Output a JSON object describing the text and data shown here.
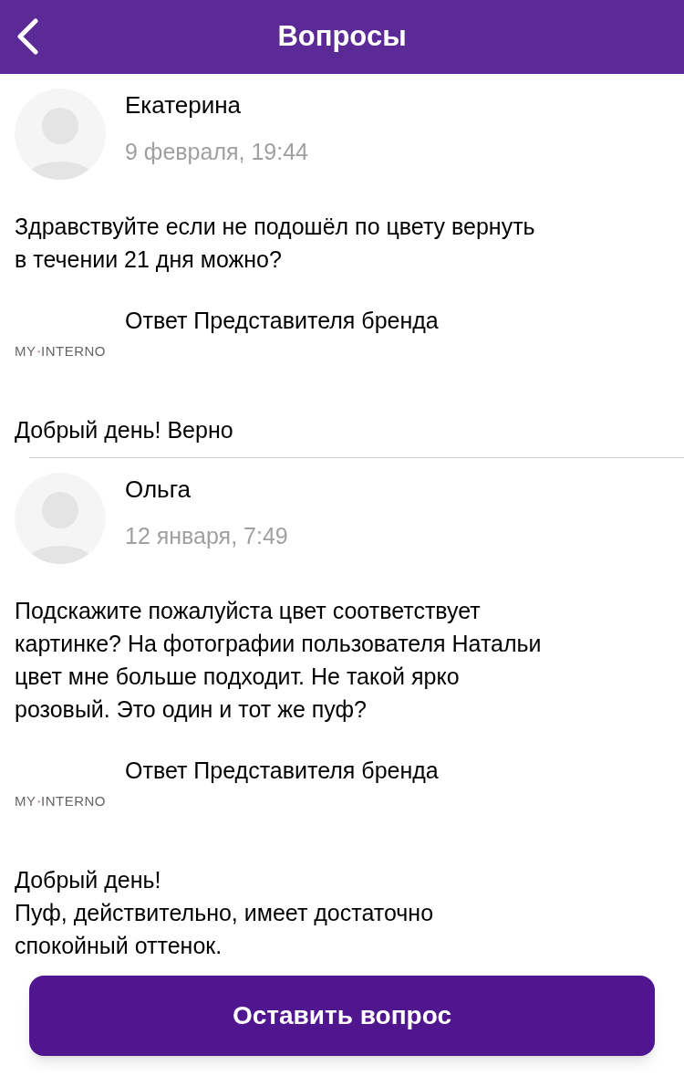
{
  "header": {
    "title": "Вопросы"
  },
  "questions": [
    {
      "author": "Екатерина",
      "date": "9 февраля, 19:44",
      "text": [
        "Здравствуйте если не подошёл по цвету вернуть",
        "в течении 21 дня можно?"
      ],
      "answer": {
        "brand_left": "MY",
        "brand_right": "INTERNO",
        "label": "Ответ Представителя бренда",
        "text": [
          "Добрый день! Верно"
        ]
      }
    },
    {
      "author": "Ольга",
      "date": "12 января, 7:49",
      "text": [
        "Подскажите пожалуйста цвет соответствует",
        "картинке? На фотографии пользователя Натальи",
        "цвет мне больше подходит. Не такой ярко",
        "розовый. Это один и тот же пуф?"
      ],
      "answer": {
        "brand_left": "MY",
        "brand_right": "INTERNO",
        "label": "Ответ Представителя бренда",
        "text": [
          "Добрый день!",
          "Пуф, действительно, имеет достаточно",
          "спокойный оттенок."
        ]
      }
    }
  ],
  "ask_button": "Оставить вопрос"
}
